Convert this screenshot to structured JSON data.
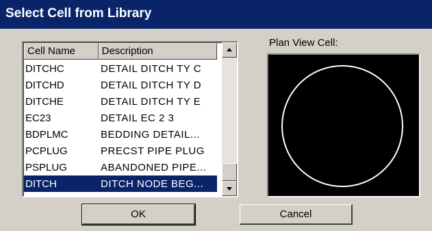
{
  "window": {
    "title": "Select Cell from Library"
  },
  "list": {
    "columns": [
      "Cell Name",
      "Description"
    ],
    "rows": [
      {
        "name": "DITCHC",
        "description": "DETAIL DITCH TY C"
      },
      {
        "name": "DITCHD",
        "description": "DETAIL DITCH TY D"
      },
      {
        "name": "DITCHE",
        "description": "DETAIL DITCH TY E"
      },
      {
        "name": "EC23",
        "description": "DETAIL EC 2 3"
      },
      {
        "name": "BDPLMC",
        "description": "BEDDING DETAIL..."
      },
      {
        "name": "PCPLUG",
        "description": "PRECST PIPE PLUG"
      },
      {
        "name": "PSPLUG",
        "description": "ABANDONED PIPE..."
      },
      {
        "name": "DITCH",
        "description": "DITCH NODE BEG..."
      }
    ],
    "selected_index": 7
  },
  "preview": {
    "label": "Plan View Cell:",
    "shape": "circle",
    "background": "#000000",
    "stroke": "#ffffff"
  },
  "buttons": {
    "ok_label": "OK",
    "cancel_label": "Cancel"
  },
  "colors": {
    "titlebar": "#0a246a",
    "selection": "#0a246a",
    "face": "#d4d0c8"
  }
}
